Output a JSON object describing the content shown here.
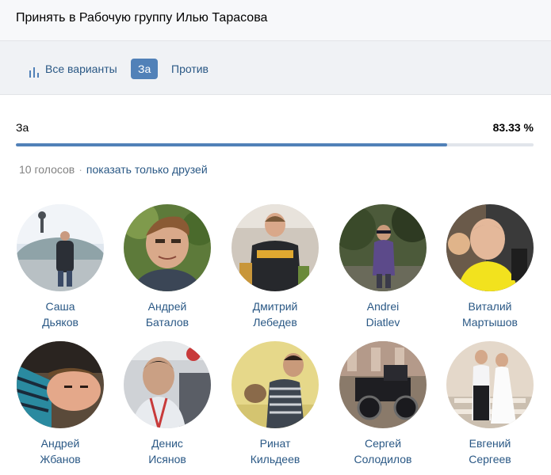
{
  "header": {
    "title": "Принять в Рабочую группу Илью Тарасова"
  },
  "tabs": {
    "all": {
      "label": "Все варианты",
      "icon": "bar-chart-icon"
    },
    "for": {
      "label": "За",
      "active": true
    },
    "against": {
      "label": "Против"
    }
  },
  "result": {
    "label": "За",
    "percent_text": "83.33 %",
    "percent": 83.33
  },
  "votes": {
    "count_text": "10 голосов",
    "separator": "·",
    "friends_link": "показать только друзей"
  },
  "voters": [
    {
      "first": "Саша",
      "last": "Дьяков"
    },
    {
      "first": "Андрей",
      "last": "Баталов"
    },
    {
      "first": "Дмитрий",
      "last": "Лебедев"
    },
    {
      "first": "Andrei",
      "last": "Diatlev"
    },
    {
      "first": "Виталий",
      "last": "Мартышов"
    },
    {
      "first": "Андрей",
      "last": "Жбанов"
    },
    {
      "first": "Денис",
      "last": "Исянов"
    },
    {
      "first": "Ринат",
      "last": "Кильдеев"
    },
    {
      "first": "Сергей",
      "last": "Солодилов"
    },
    {
      "first": "Евгений",
      "last": "Сергеев"
    }
  ],
  "colors": {
    "accent": "#5181b8",
    "link": "#2a5885",
    "track": "#e1e5eb",
    "muted": "#828282"
  }
}
